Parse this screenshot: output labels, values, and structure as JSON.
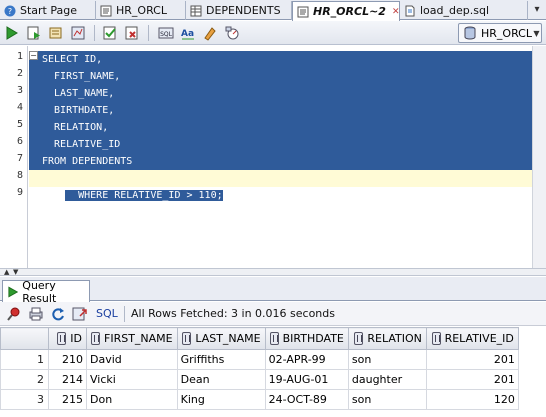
{
  "tabs": [
    {
      "label": "Start Page",
      "icon": "help-icon"
    },
    {
      "label": "HR_ORCL",
      "icon": "sql-worksheet-icon"
    },
    {
      "label": "DEPENDENTS",
      "icon": "table-icon"
    },
    {
      "label": "HR_ORCL~2",
      "icon": "sql-worksheet-icon",
      "active": true
    },
    {
      "label": "load_dep.sql",
      "icon": "sql-file-icon"
    }
  ],
  "toolbar": {
    "connection": "HR_ORCL"
  },
  "editor": {
    "line_numbers": [
      "1",
      "2",
      "3",
      "4",
      "5",
      "6",
      "7",
      "8",
      "9"
    ],
    "lines": [
      "SELECT ID,",
      "  FIRST_NAME,",
      "  LAST_NAME,",
      "  BIRTHDATE,",
      "  RELATION,",
      "  RELATIVE_ID",
      "FROM DEPENDENTS",
      "WHERE RELATIVE_ID > 110;",
      ""
    ]
  },
  "result": {
    "tab_label": "Query Result",
    "sql_label": "SQL",
    "status": "All Rows Fetched: 3 in 0.016 seconds",
    "columns": [
      "ID",
      "FIRST_NAME",
      "LAST_NAME",
      "BIRTHDATE",
      "RELATION",
      "RELATIVE_ID"
    ],
    "rows": [
      {
        "num": "1",
        "cells": [
          "210",
          "David",
          "Griffiths",
          "02-APR-99",
          "son",
          "201"
        ]
      },
      {
        "num": "2",
        "cells": [
          "214",
          "Vicki",
          "Dean",
          "19-AUG-01",
          "daughter",
          "201"
        ]
      },
      {
        "num": "3",
        "cells": [
          "215",
          "Don",
          "King",
          "24-OCT-89",
          "son",
          "120"
        ]
      }
    ]
  },
  "colors": {
    "selection": "#2f5b9a",
    "current_line": "#fffbd6",
    "tab_bar": "#e9ecf3"
  }
}
